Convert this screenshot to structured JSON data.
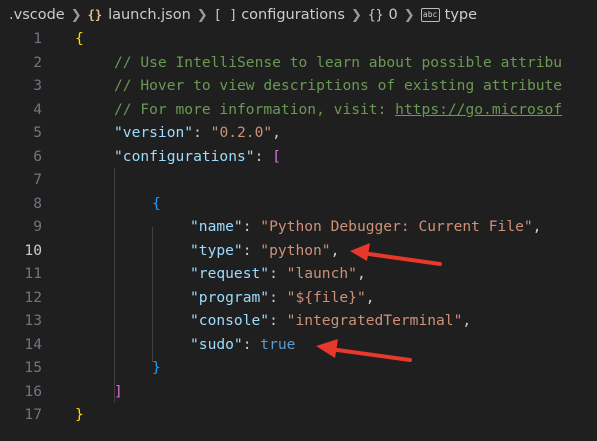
{
  "breadcrumb": {
    "items": [
      ".vscode",
      "launch.json",
      "configurations",
      "0",
      "type"
    ],
    "icons": [
      "folder",
      "json-braces-icon",
      "array-icon",
      "object-icon",
      "string-type-icon"
    ],
    "array_icon_text": "[ ]",
    "object_icon_text": "{}",
    "type_icon_text": "abc",
    "json_icon_text": "{}"
  },
  "editor": {
    "active_line": 10,
    "lines": [
      {
        "n": "1",
        "t": "{"
      },
      {
        "n": "2",
        "t": "// Use IntelliSense to learn about possible attribu"
      },
      {
        "n": "3",
        "t": "// Hover to view descriptions of existing attribute"
      },
      {
        "n": "4",
        "t": "// For more information, visit: https://go.microsof"
      },
      {
        "n": "5",
        "t": "\"version\": \"0.2.0\","
      },
      {
        "n": "6",
        "t": "\"configurations\": ["
      },
      {
        "n": "7",
        "t": ""
      },
      {
        "n": "8",
        "t": "{"
      },
      {
        "n": "9",
        "t": "\"name\": \"Python Debugger: Current File\","
      },
      {
        "n": "10",
        "t": "\"type\": \"python\","
      },
      {
        "n": "11",
        "t": "\"request\": \"launch\","
      },
      {
        "n": "12",
        "t": "\"program\": \"${file}\","
      },
      {
        "n": "13",
        "t": "\"console\": \"integratedTerminal\","
      },
      {
        "n": "14",
        "t": "\"sudo\": true"
      },
      {
        "n": "15",
        "t": "}"
      },
      {
        "n": "16",
        "t": "]"
      },
      {
        "n": "17",
        "t": "}"
      }
    ]
  },
  "tokens": {
    "l2": "// Use IntelliSense to learn about possible attribu",
    "l3": "// Hover to view descriptions of existing attribute",
    "l4a": "// For more information, visit: ",
    "l4b": "https://go.microsof",
    "version_key": "\"version\"",
    "version_val": "\"0.2.0\"",
    "configurations_key": "\"configurations\"",
    "name_key": "\"name\"",
    "name_val": "\"Python Debugger: Current File\"",
    "type_key": "\"type\"",
    "type_val": "\"python\"",
    "request_key": "\"request\"",
    "request_val": "\"launch\"",
    "program_key": "\"program\"",
    "program_val": "\"${file}\"",
    "console_key": "\"console\"",
    "console_val": "\"integratedTerminal\"",
    "sudo_key": "\"sudo\"",
    "sudo_val": "true",
    "brace_open": "{",
    "brace_close": "}",
    "bracket_open": "[",
    "bracket_close": "]",
    "colon": ": ",
    "comma": ","
  },
  "colors": {
    "background": "#1f1f1f",
    "annotation_arrow": "#e8382c"
  }
}
